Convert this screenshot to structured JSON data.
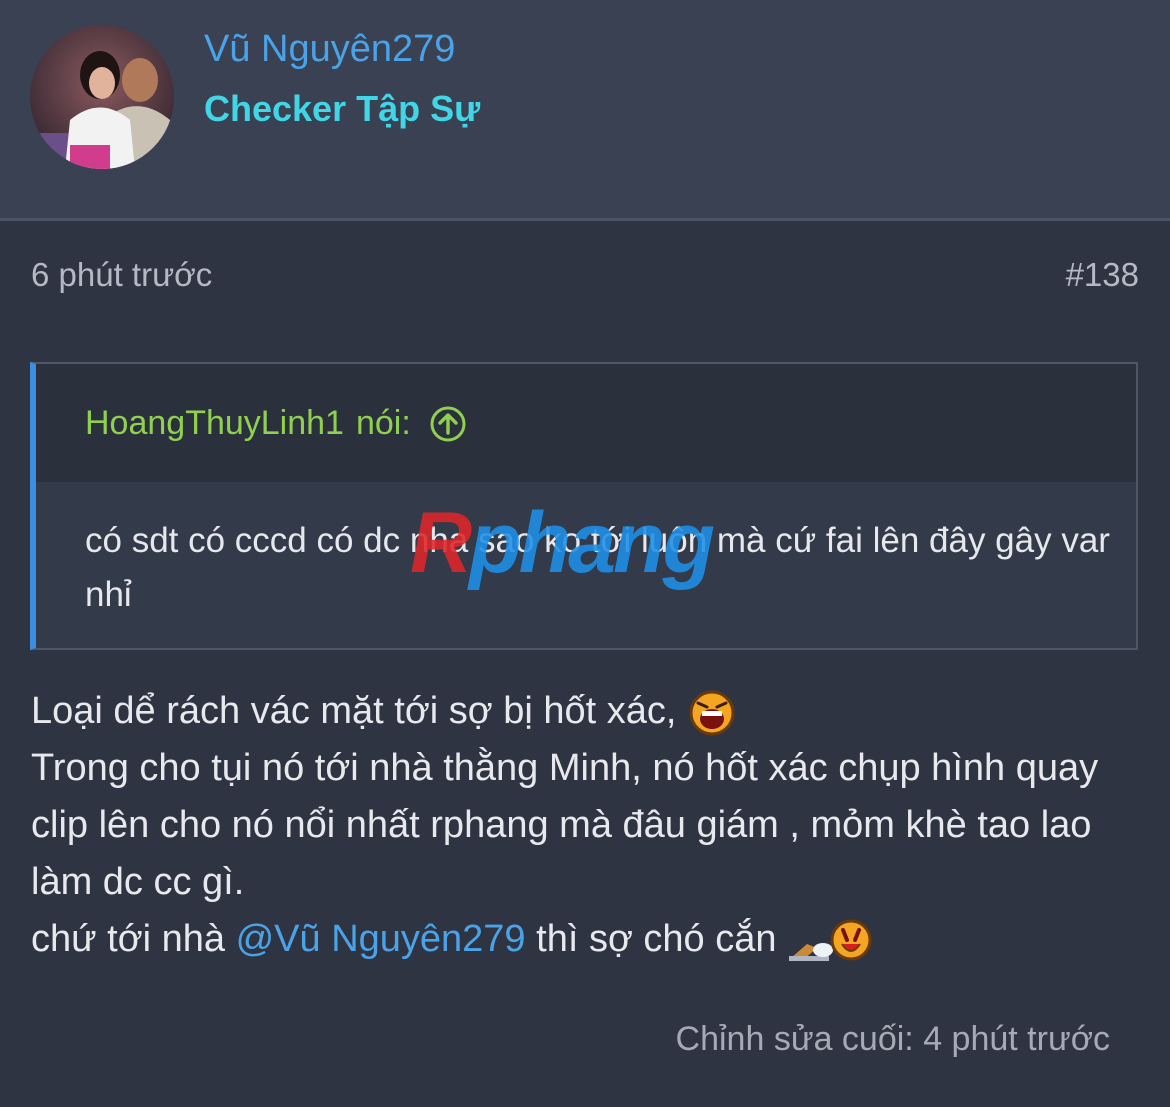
{
  "user": {
    "name": "Vũ Nguyên279",
    "title": "Checker Tập Sự"
  },
  "post": {
    "time": "6 phút trước",
    "number": "#138",
    "quote": {
      "author": "HoangThuyLinh1",
      "said_label": "nói:",
      "text": "có sdt có cccd có dc nha sao ko tới luôn mà cứ fai lên đây gây var nhỉ"
    },
    "lines": {
      "line1": "Loại dể rách vác mặt tới sợ bị hốt xác,",
      "line2": "Trong cho tụi nó tới nhà thằng Minh, nó hốt xác chụp hình quay clip lên cho nó nổi nhất rphang mà đâu giám , mỏm khè tao lao làm dc cc gì.",
      "line3_prefix": "chứ tới nhà",
      "line3_mention": "@Vũ Nguyên279",
      "line3_suffix": "thì sợ chó cắn"
    },
    "edited": "Chỉnh sửa cuối: 4 phút trước"
  },
  "watermark": {
    "first_letter": "R",
    "rest": "phang"
  },
  "icons": {
    "quote_arrow": "arrow-up-circle-icon",
    "emoji_laugh": "laughing-emoji-icon",
    "emoji_dog": "dog-bite-emoji-icon"
  },
  "colors": {
    "background": "#2f3442",
    "header": "#394152",
    "username": "#4aa3e8",
    "user_title": "#41d6e6",
    "quote_author": "#8fd14f",
    "quote_border": "#3b8fe0"
  }
}
